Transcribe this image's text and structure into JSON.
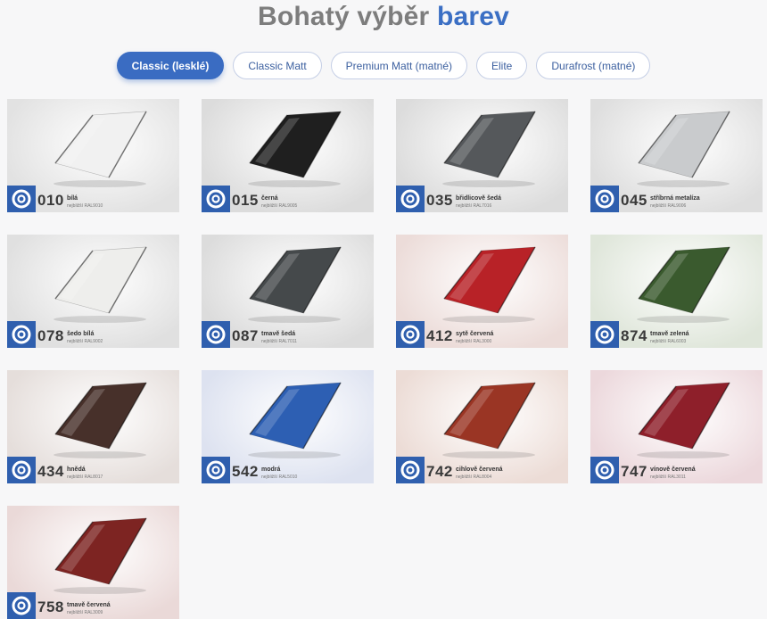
{
  "heading": {
    "main": "Bohatý výběr",
    "accent": "barev"
  },
  "tabs": [
    {
      "label": "Classic (lesklé)",
      "active": true
    },
    {
      "label": "Classic Matt",
      "active": false
    },
    {
      "label": "Premium Matt (matné)",
      "active": false
    },
    {
      "label": "Elite",
      "active": false
    },
    {
      "label": "Durafrost (matné)",
      "active": false
    }
  ],
  "colors": [
    {
      "code": "010",
      "name": "bílá",
      "ral": "nejbližší RAL9010",
      "sheet": "#f1f1f1",
      "bg": "#e2e2e2"
    },
    {
      "code": "015",
      "name": "černá",
      "ral": "nejbližší RAL9005",
      "sheet": "#1f1f1f",
      "bg": "#dcdcdc"
    },
    {
      "code": "035",
      "name": "břidlicově šedá",
      "ral": "nejbližší RAL7016",
      "sheet": "#55585b",
      "bg": "#dcdcdc"
    },
    {
      "code": "045",
      "name": "stříbrná metalíza",
      "ral": "nejbližší RAL9006",
      "sheet": "#c9cbcd",
      "bg": "#dedede"
    },
    {
      "code": "078",
      "name": "šedo bílá",
      "ral": "nejbližší RAL9002",
      "sheet": "#eeeeec",
      "bg": "#e0e0e0"
    },
    {
      "code": "087",
      "name": "tmavě šedá",
      "ral": "nejbližší RAL7011",
      "sheet": "#45494b",
      "bg": "#dcdcdc"
    },
    {
      "code": "412",
      "name": "sytě červená",
      "ral": "nejbližší RAL3000",
      "sheet": "#b82227",
      "bg": "#ecdcd9"
    },
    {
      "code": "874",
      "name": "tmavě zelená",
      "ral": "nejbližší RAL6003",
      "sheet": "#3a5a2e",
      "bg": "#dfe6da"
    },
    {
      "code": "434",
      "name": "hnědá",
      "ral": "nejbližší RAL8017",
      "sheet": "#47302a",
      "bg": "#e5dedb"
    },
    {
      "code": "542",
      "name": "modrá",
      "ral": "nejbližší RAL5010",
      "sheet": "#2d5fb3",
      "bg": "#dde2f0"
    },
    {
      "code": "742",
      "name": "cihlově červená",
      "ral": "nejbližší RAL8004",
      "sheet": "#9a3524",
      "bg": "#ecdcd6"
    },
    {
      "code": "747",
      "name": "vínově červená",
      "ral": "nejbližší RAL3011",
      "sheet": "#8e1f2a",
      "bg": "#ecd8dc"
    },
    {
      "code": "758",
      "name": "tmavě červená",
      "ral": "nejbližší RAL3009",
      "sheet": "#7d2422",
      "bg": "#ead9d8"
    }
  ]
}
